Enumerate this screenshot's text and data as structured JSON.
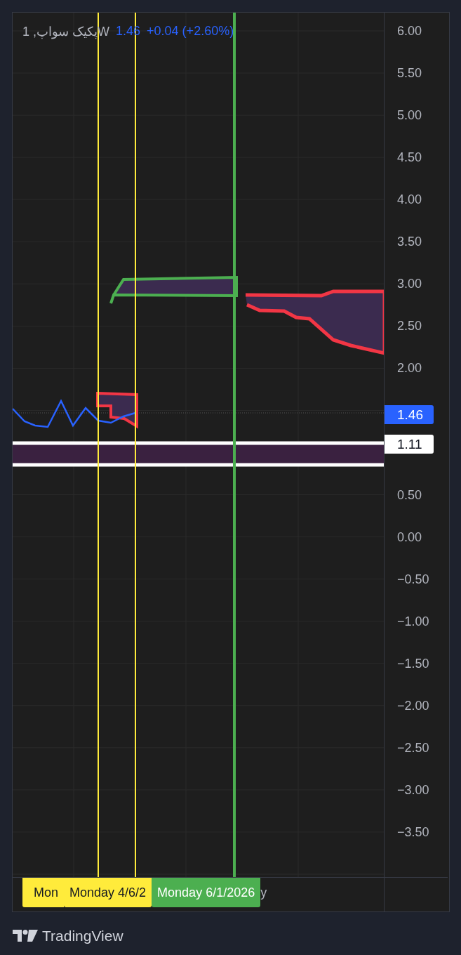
{
  "legend": {
    "symbol": "پکیک سواپ, 1W",
    "price": "1.46",
    "change": "+0.04 (+2.60%)"
  },
  "price_axis": {
    "upper_ticks": [
      "6.00",
      "5.50",
      "5.00",
      "4.50",
      "4.00",
      "3.50",
      "3.00",
      "2.50",
      "2.00"
    ],
    "lower_ticks": [
      "0.50",
      "0.00",
      "−0.50",
      "−1.00",
      "−1.50",
      "−2.00",
      "−2.50",
      "−3.00",
      "−3.50"
    ]
  },
  "price_labels": [
    {
      "text": "1.46",
      "kind": "last"
    },
    {
      "text": "1.11",
      "kind": "line"
    }
  ],
  "time_axis": {
    "labels": [
      {
        "text": "Mon",
        "kind": "marker",
        "color": "#ffeb3b"
      },
      {
        "text": "Monday 4/6/2",
        "kind": "marker",
        "color": "#ffeb3b"
      },
      {
        "text": "Monday 6/1/2026",
        "kind": "marker",
        "color": "#4caf50"
      },
      {
        "text": "y",
        "kind": "date"
      }
    ]
  },
  "branding": {
    "name": "TradingView"
  }
}
